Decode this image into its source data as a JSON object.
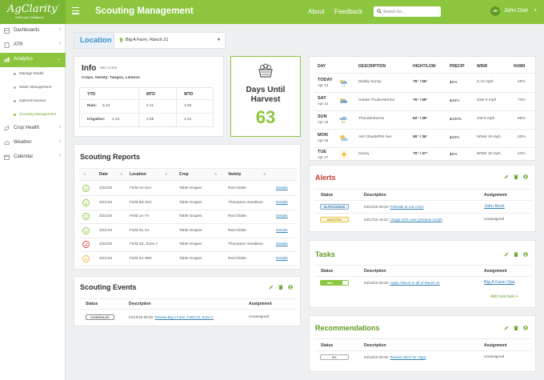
{
  "header": {
    "logo": "AgClarity",
    "logo_tm": "™",
    "logo_sub": "Multi-Layer Intelligence",
    "title": "Scouting Management",
    "nav": [
      "About",
      "Feedback"
    ],
    "search_placeholder": "Search for...",
    "user_initials": "JD",
    "user_name": "John Doe",
    "colors": {
      "bar": "#8cc63f",
      "logo_bg": "#7ab534"
    }
  },
  "sidebar": {
    "items": [
      {
        "label": "Dashboards",
        "icon": "dashboard-icon"
      },
      {
        "label": "ATR",
        "icon": "document-icon"
      },
      {
        "label": "Analytics",
        "icon": "analytics-icon",
        "active": true
      },
      {
        "label": "Crop Health",
        "icon": "leaf-icon"
      },
      {
        "label": "Weather",
        "icon": "cloud-icon"
      },
      {
        "label": "Calendar",
        "icon": "calendar-icon"
      }
    ],
    "sub_items": [
      "Manage Model",
      "Water Management",
      "Optimal Harvest",
      "Scouting Management"
    ]
  },
  "location": {
    "label": "Location",
    "value": "Big A Farm, Ranch 21"
  },
  "info": {
    "title": "Info",
    "acres": "852 Acres",
    "crops_line": "Crops, Variety: Tangos, Lemons",
    "cols": [
      "YTD",
      "MTD",
      "WTD"
    ],
    "rows": [
      {
        "label": "Rain:",
        "values": [
          "6.23",
          "2.11",
          "1.65"
        ]
      },
      {
        "label": "Irrigation:",
        "values": [
          "1.44",
          "4.65",
          "1.01"
        ]
      }
    ]
  },
  "harvest": {
    "label_1": "Days Until",
    "label_2": "Harvest",
    "days": "63"
  },
  "weather": {
    "cols": [
      "DAY",
      "DESCRIPTION",
      "HIGHT/LOW",
      "PRECIP",
      "WIND",
      "HUMII"
    ],
    "rows": [
      {
        "day": "TODAY",
        "date": "Apr 13",
        "icon": "partly-cloudy-rain-icon",
        "desc": "Mostly Sunny",
        "hilo": "75° / 56°",
        "precip": "0%",
        "wind": "S 12 mph",
        "hum": "40%"
      },
      {
        "day": "SAT",
        "date": "Apr 14",
        "icon": "storm-cloud-icon",
        "desc": "Isolate Thuderstorms",
        "hilo": "75° / 59°",
        "precip": "30%",
        "wind": "SSE 9 mph",
        "hum": "74%"
      },
      {
        "day": "SUN",
        "date": "Apr 15",
        "icon": "thunder-rain-icon",
        "desc": "Thunderstorms",
        "hilo": "62° / 39°",
        "precip": "100%",
        "wind": "SW 9 mph",
        "hum": "85%"
      },
      {
        "day": "MON",
        "date": "Apr 16",
        "icon": "sun-cloud-icon",
        "desc": "AM Clouds/PM Sun",
        "hilo": "55° / 36°",
        "precip": "20%",
        "wind": "WNW 15 mph",
        "hum": "53%"
      },
      {
        "day": "TUE",
        "date": "Apr 17",
        "icon": "sun-icon",
        "desc": "Sunny",
        "hilo": "70° / 47°",
        "precip": "0%",
        "wind": "WNW 10 mph",
        "hum": "44%"
      }
    ]
  },
  "reports": {
    "title": "Scouting Reports",
    "cols": [
      "Date",
      "Location",
      "Crop",
      "Variety"
    ],
    "details_label": "Details",
    "rows": [
      {
        "face": "smile",
        "date": "4/21/18",
        "loc": "Field AV-31A",
        "crop": "Table Grapes",
        "variety": "Red Globe"
      },
      {
        "face": "smile",
        "date": "4/21/18",
        "loc": "Field BZ 91C",
        "crop": "Table Grapes",
        "variety": "Thompson Seedless"
      },
      {
        "face": "smile",
        "date": "4/21/18",
        "loc": "Field JA-7A",
        "crop": "Table Grapes",
        "variety": "Red Globe"
      },
      {
        "face": "smile",
        "date": "4/21/18",
        "loc": "Field KL-21",
        "crop": "Table Grapes",
        "variety": "Red Globe"
      },
      {
        "face": "sad",
        "date": "4/21/18",
        "loc": "Field ZZ, Zone A",
        "crop": "Table Grapes",
        "variety": "Thompson Seedless"
      },
      {
        "face": "neutral",
        "date": "4/21/18",
        "loc": "Field ZA-98C",
        "crop": "Table Grapes",
        "variety": "Red Globe"
      }
    ]
  },
  "events": {
    "title": "Scouting Events",
    "cols": [
      "Status",
      "Description",
      "Assignment"
    ],
    "rows": [
      {
        "status": "SCHEDULED",
        "desc_prefix": "04/10/18 08:30:",
        "desc_link": "Review Big A Farm, Field 22, Zone A",
        "assign": "Unassigned"
      }
    ]
  },
  "alerts": {
    "title": "Alerts",
    "cols": [
      "Status",
      "Description",
      "Assignment"
    ],
    "rows": [
      {
        "status": "IN-PROGRESS",
        "desc_prefix": "04/12/18 09:33:",
        "desc_link": "Pelewak at row A312",
        "assign": "John Bock",
        "assign_link": true
      },
      {
        "status": "AWAITING",
        "desc_prefix": "04/17/18 16:21:",
        "desc_link": "Usage 22% over previous month",
        "assign": "Unassigned",
        "assign_link": false
      }
    ]
  },
  "tasks": {
    "title": "Tasks",
    "cols": [
      "Status",
      "Description",
      "Assignment"
    ],
    "rows": [
      {
        "status": "80%",
        "progress": 0.8,
        "desc_prefix": "04/10/18 08:30:",
        "desc_link": "Apply Altacor to all of Ranch 21",
        "assign": "Big A Farm Ops"
      }
    ],
    "add_label": "Add new task"
  },
  "recs": {
    "title": "Recommendations",
    "cols": [
      "Status",
      "Description",
      "Assignment"
    ],
    "rows": [
      {
        "status": "0%",
        "progress": 0,
        "desc_prefix": "04/10/18 08:30:",
        "desc_link": "Review NDVI for Vigor",
        "assign": "Unassigned"
      }
    ]
  }
}
